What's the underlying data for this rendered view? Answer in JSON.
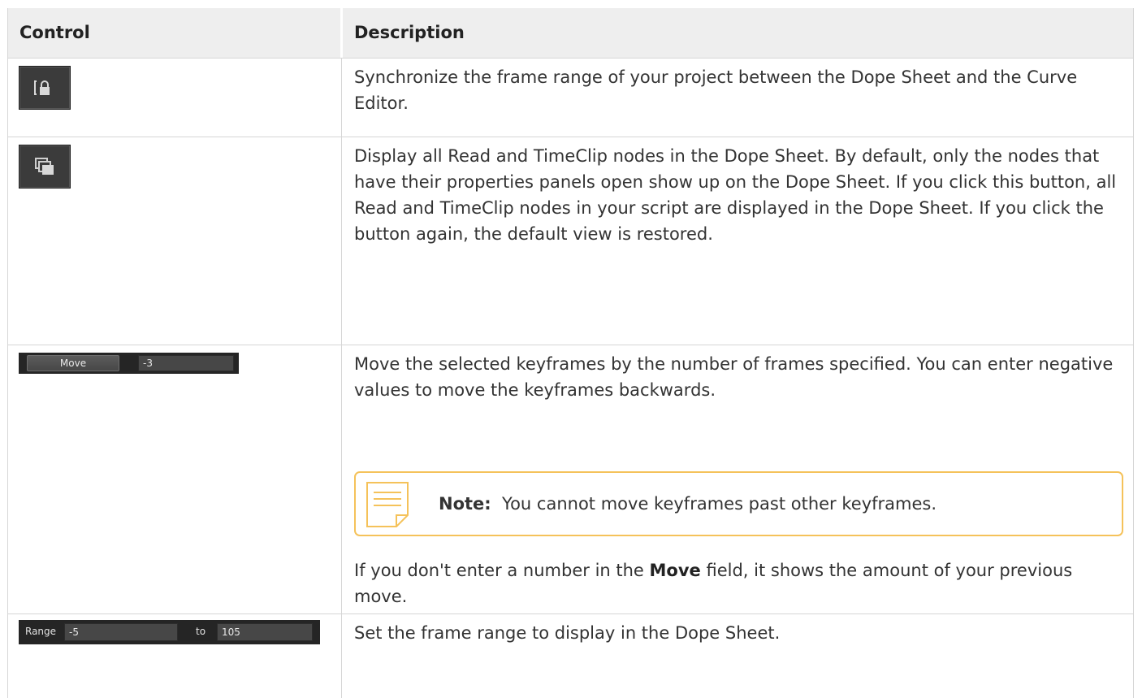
{
  "header": {
    "col_control": "Control",
    "col_description": "Description"
  },
  "rows": [
    {
      "icon": "lock-sync-icon",
      "description": "Synchronize the frame range of your project between the Dope Sheet and the Curve Editor."
    },
    {
      "icon": "stacked-windows-icon",
      "description": "Display all Read and TimeClip nodes in the Dope Sheet. By default, only the nodes that have their properties panels open show up on the Dope Sheet. If you click this button, all Read and TimeClip nodes in your script are displayed in the Dope Sheet. If you click the button again, the default view is restored."
    },
    {
      "move_button": "Move",
      "move_value": "-3",
      "description": "Move the selected keyframes by the number of frames specified. You can enter negative values to move the keyframes backwards.",
      "note_label": "Note:",
      "note_text": "You cannot move keyframes past other keyframes.",
      "after_prefix": "If you don't enter a number in the ",
      "after_bold": "Move",
      "after_suffix": " field, it shows the amount of your previous move."
    },
    {
      "range_label": "Range",
      "range_from": "-5",
      "to_label": "to",
      "range_to": "105",
      "description": "Set the frame range to display in the Dope Sheet."
    }
  ],
  "colors": {
    "note_border": "#f5c25a",
    "widget_bg": "#3b3b3b",
    "header_bg": "#eeeeee"
  }
}
